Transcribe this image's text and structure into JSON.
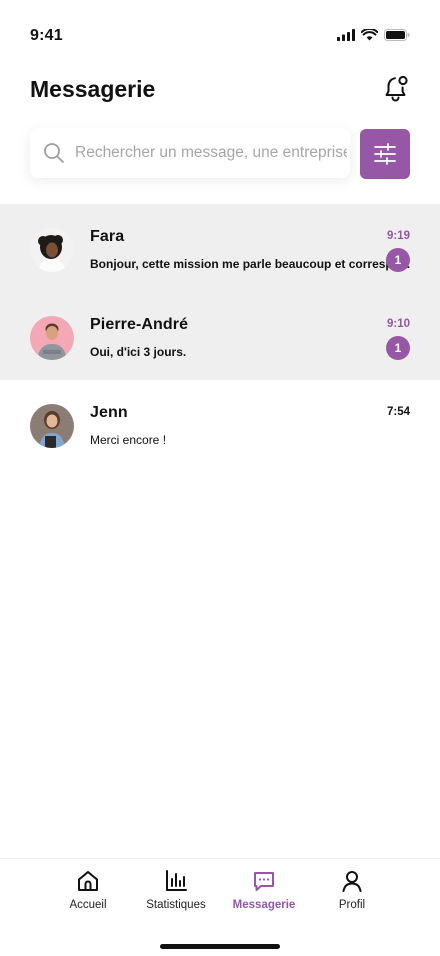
{
  "status_bar": {
    "time": "9:41"
  },
  "header": {
    "title": "Messagerie"
  },
  "search": {
    "placeholder": "Rechercher un message, une entreprise",
    "value": ""
  },
  "colors": {
    "accent": "#9557a6",
    "unread_background": "#efefef"
  },
  "icons": {
    "notification": "bell-icon",
    "search": "search-icon",
    "filter": "sliders-icon"
  },
  "conversations": [
    {
      "name": "Fara",
      "preview": "Bonjour, cette mission me parle beaucoup et correspo...",
      "time": "9:19",
      "unread_count": "1",
      "unread": true
    },
    {
      "name": "Pierre-André",
      "preview": "Oui, d'ici 3 jours.",
      "time": "9:10",
      "unread_count": "1",
      "unread": true
    },
    {
      "name": "Jenn",
      "preview": "Merci encore !",
      "time": "7:54",
      "unread": false
    }
  ],
  "tabbar": {
    "items": [
      {
        "label": "Accueil",
        "icon": "home-icon"
      },
      {
        "label": "Statistiques",
        "icon": "bar-chart-icon"
      },
      {
        "label": "Messagerie",
        "icon": "chat-icon",
        "active": true
      },
      {
        "label": "Profil",
        "icon": "user-icon"
      }
    ]
  }
}
